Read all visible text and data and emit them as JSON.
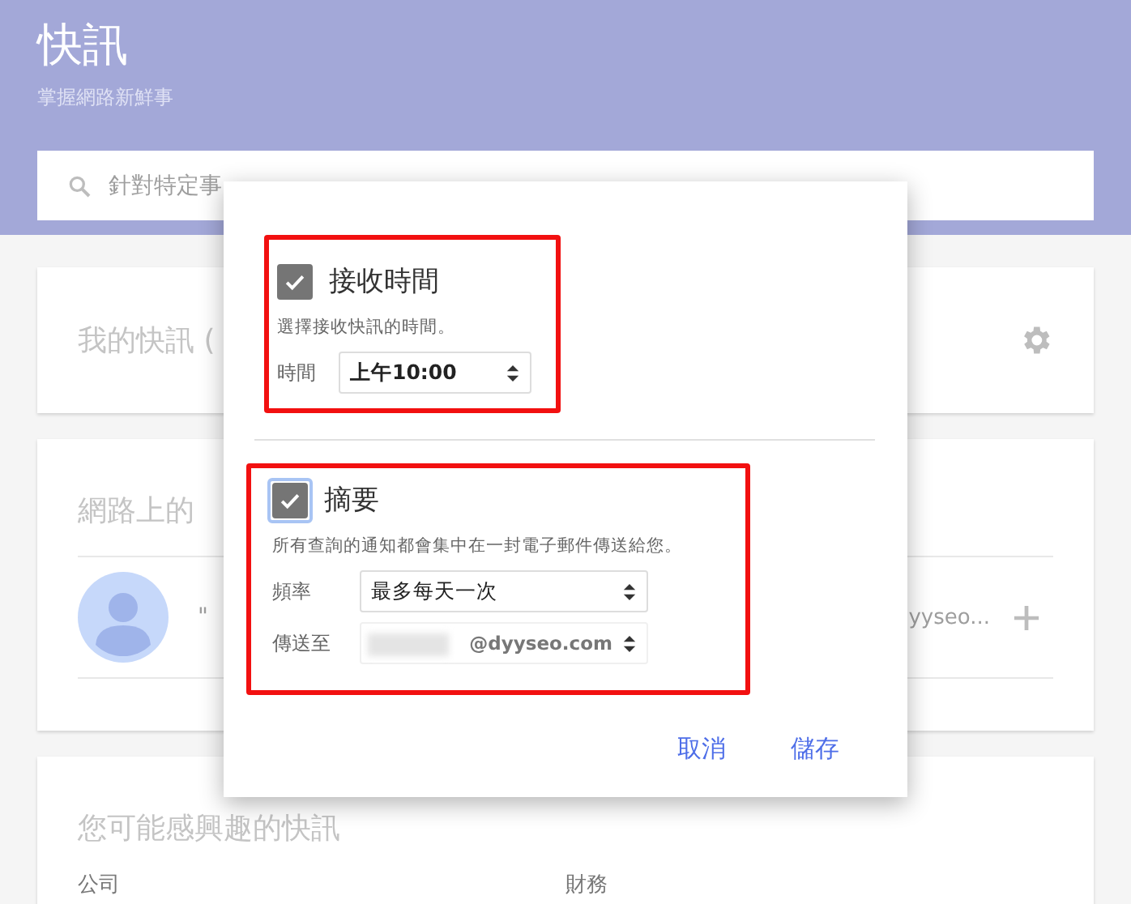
{
  "header": {
    "title": "快訊",
    "subtitle": "掌握網路新鮮事",
    "search": {
      "placeholder": "針對特定事"
    }
  },
  "cards": [
    {
      "kind": "settings",
      "title": "我的快訊 ("
    },
    {
      "kind": "alerts",
      "title": "網路上的",
      "row": {
        "quote": "\"",
        "trail": "yyseo..."
      }
    },
    {
      "kind": "suggest",
      "title": "您可能感興趣的快訊",
      "columns": [
        "公司",
        "財務"
      ]
    }
  ],
  "dialog": {
    "sections": [
      {
        "title": "接收時間",
        "checked": true,
        "focused": false,
        "highlighted": true,
        "description": "選擇接收快訊的時間。",
        "fields": [
          {
            "label": "時間",
            "value": "上午10:00",
            "bold": true,
            "blurred": false
          }
        ]
      },
      {
        "title": "摘要",
        "checked": true,
        "focused": true,
        "highlighted": true,
        "description": "所有查詢的通知都會集中在一封電子郵件傳送給您。",
        "fields": [
          {
            "label": "頻率",
            "value": "最多每天一次",
            "bold": false,
            "blurred": false
          },
          {
            "label": "傳送至",
            "value": "@dyyseo.com",
            "bold": true,
            "blurred": true
          }
        ]
      }
    ],
    "buttons": [
      "取消",
      "儲存"
    ]
  }
}
